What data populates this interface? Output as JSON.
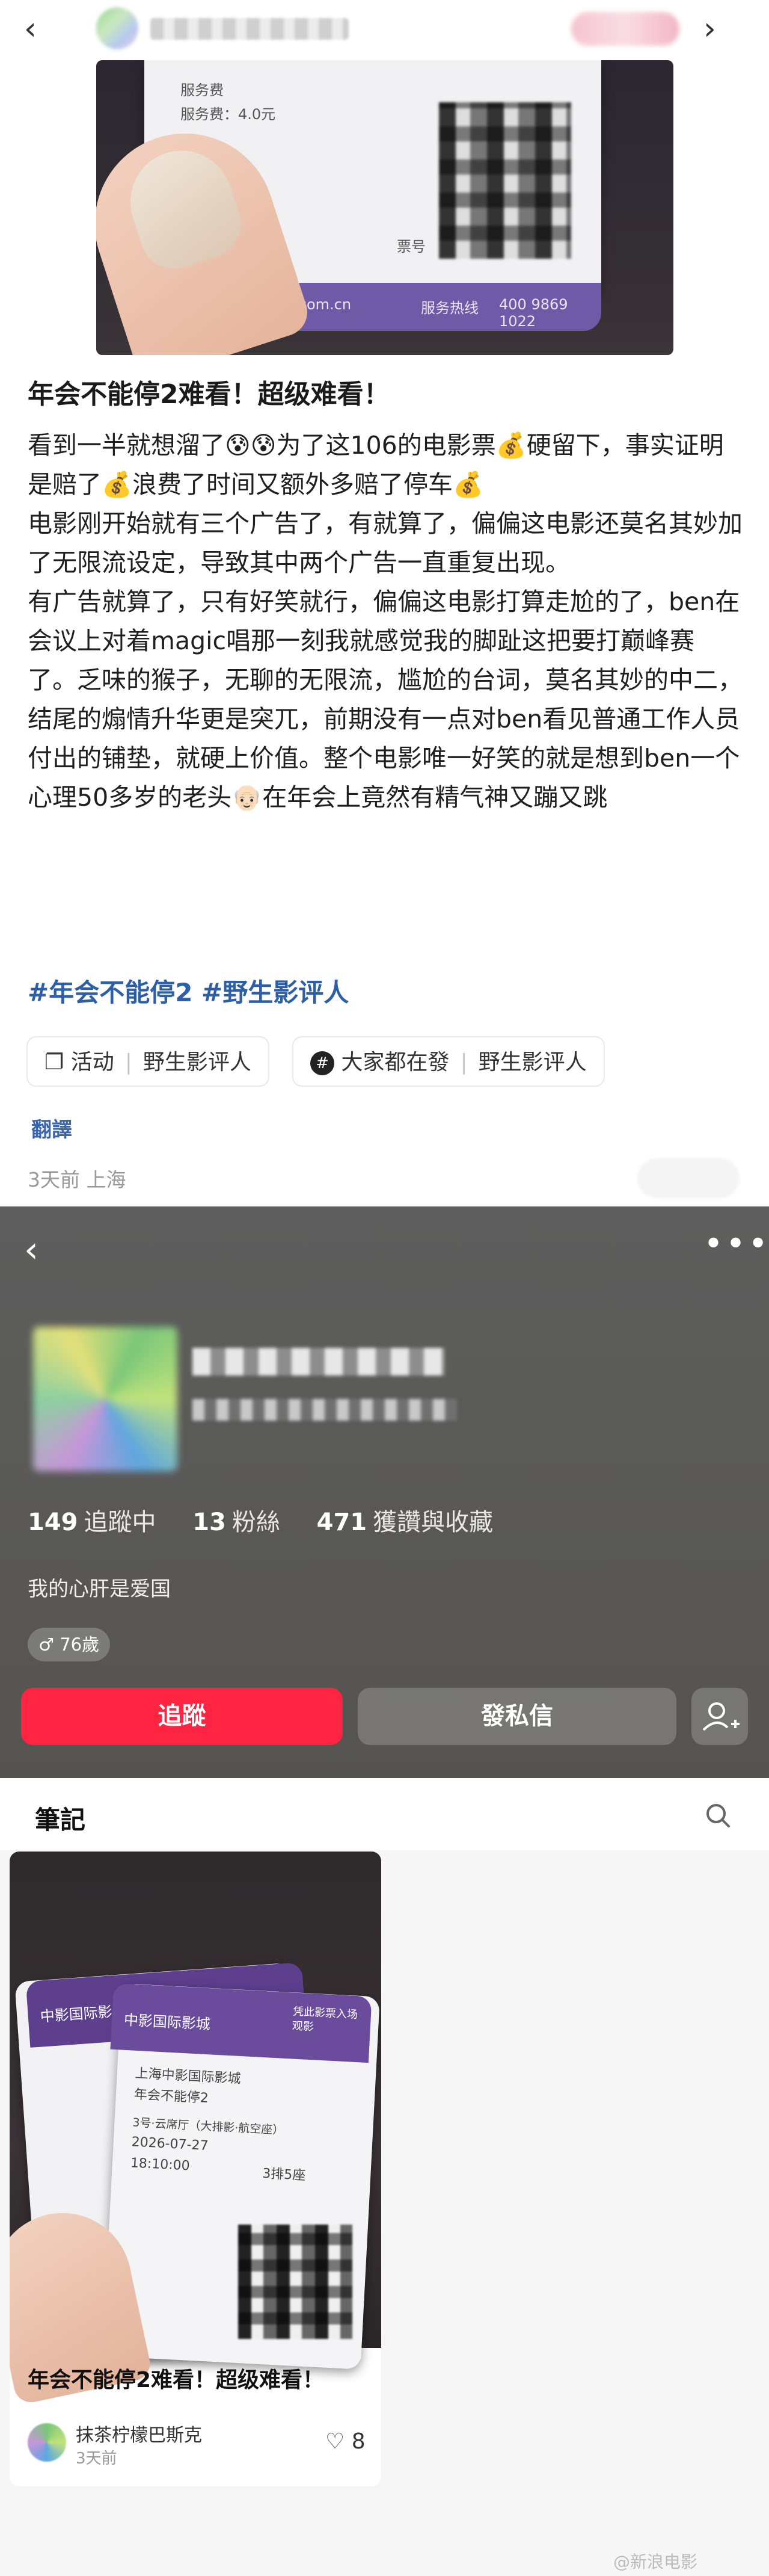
{
  "post": {
    "title": "年会不能停2难看！超级难看！",
    "paragraphs": [
      "看到一半就想溜了😰😰为了这106的电影票💰硬留下，事实证明是赔了💰浪费了时间又额外多赔了停车💰",
      "电影刚开始就有三个广告了，有就算了，偏偏这电影还莫名其妙加了无限流设定，导致其中两个广告一直重复出现。",
      "有广告就算了，只有好笑就行，偏偏这电影打算走尬的了，ben在会议上对着magic唱那一刻我就感觉我的脚趾这把要打巅峰赛了。乏味的猴子，无聊的无限流，尴尬的台词，莫名其妙的中二，结尾的煽情升华更是突兀，前期没有一点对ben看见普通工作人员付出的铺垫，就硬上价值。整个电影唯一好笑的就是想到ben一个心理50多岁的老头👴🏻在年会上竟然有精气神又蹦又跳"
    ],
    "hashtags": "#年会不能停2 #野生影评人",
    "chip1": {
      "type": "活动",
      "name": "野生影评人"
    },
    "chip2": {
      "type": "大家都在發",
      "name": "野生影评人"
    },
    "translate": "翻譯",
    "meta": "3天前 上海"
  },
  "photo_ticket": {
    "fee": "服务费：4.0元",
    "fee_label": "服务费",
    "site": "www.cfc.com.cn",
    "hotline": "服务热线",
    "number": "400 9869 1022",
    "ticket_no": "票号"
  },
  "profile": {
    "stats": [
      {
        "num": "149",
        "label": "追蹤中"
      },
      {
        "num": "13",
        "label": "粉絲"
      },
      {
        "num": "471",
        "label": "獲讚與收藏"
      }
    ],
    "bio": "我的心肝是爱国",
    "age": "♂ 76歲",
    "follow_label": "追蹤",
    "message_label": "發私信"
  },
  "notes": {
    "tab": "筆記",
    "card": {
      "title": "年会不能停2难看！超级难看！",
      "author": "抹茶柠檬巴斯克",
      "time": "3天前",
      "likes": "8",
      "ticket_texts": {
        "brand": "中影国际影城",
        "cinema": "上海中影国际影城",
        "movie": "年会不能停2",
        "hall": "3号·云席厅（大排影·航空座）",
        "date": "2026-07-27",
        "time": "18:10:00",
        "row": "3排5座",
        "badge": "凭此影票入场观影"
      }
    }
  },
  "watermark": "@新浪电影"
}
